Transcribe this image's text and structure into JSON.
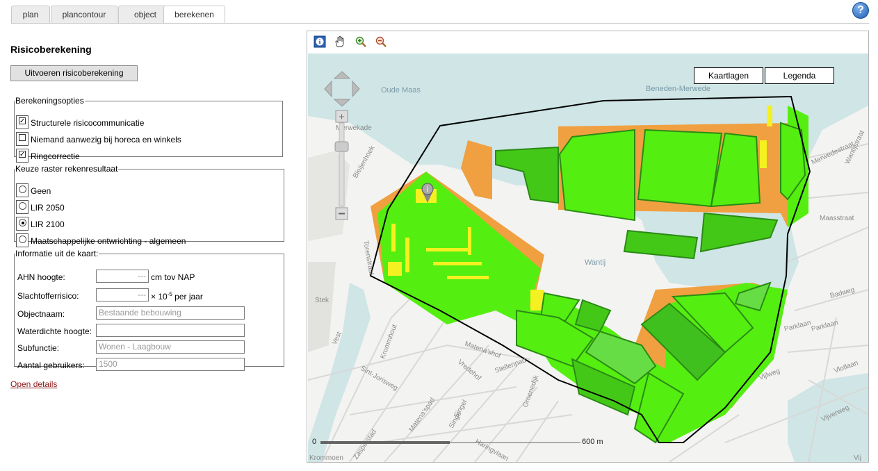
{
  "tabs": [
    {
      "label": "plan",
      "active": false
    },
    {
      "label": "plancontour",
      "active": false
    },
    {
      "label": "object",
      "active": false
    },
    {
      "label": "berekenen",
      "active": true
    }
  ],
  "help_icon": "?",
  "heading": "Risicoberekening",
  "run_button": "Uitvoeren risicoberekening",
  "options": {
    "legend": "Berekeningsopties",
    "items": [
      {
        "label": "Structurele risicocommunicatie",
        "checked": true
      },
      {
        "label": "Niemand aanwezig bij horeca en winkels",
        "checked": false
      },
      {
        "label": "Ringcorrectie",
        "checked": true
      }
    ]
  },
  "raster": {
    "legend": "Keuze raster rekenresultaat",
    "items": [
      {
        "label": "Geen",
        "selected": false
      },
      {
        "label": "LIR 2050",
        "selected": false
      },
      {
        "label": "LIR 2100",
        "selected": true
      },
      {
        "label": "Maatschappelijke ontwrichting - algemeen",
        "selected": false
      }
    ]
  },
  "info": {
    "legend": "Informatie uit de kaart:",
    "ahn": {
      "label": "AHN hoogte:",
      "value": "---",
      "unit": "cm tov NAP"
    },
    "risk": {
      "label": "Slachtofferrisico:",
      "value": "---",
      "unit_prefix": "× 10",
      "unit_exp": "-5",
      "unit_suffix": " per jaar"
    },
    "object_name": {
      "label": "Objectnaam:",
      "value": "Bestaande bebouwing"
    },
    "waterproof": {
      "label": "Waterdichte hoogte:",
      "value": ""
    },
    "subfunction": {
      "label": "Subfunctie:",
      "value": "Wonen - Laagbouw"
    },
    "users": {
      "label": "Aantal gebruikers:",
      "value": "1500"
    }
  },
  "open_details": "Open details",
  "map": {
    "buttons": {
      "layers": "Kaartlagen",
      "legend": "Legenda"
    },
    "scale": {
      "start": "0",
      "end": "600 m"
    },
    "labels": [
      "Oude Maas",
      "Beneden-Merwede",
      "Merwekade",
      "Bleijenhoek",
      "Wantij",
      "Torenstraat",
      "Vest",
      "Stek",
      "Krommhout",
      "Matena'shof",
      "Vredehof",
      "Stellenpad",
      "Sint-Jorisweg",
      "Matena'spad",
      "Singel",
      "Groenedijk",
      "Merwedestraat",
      "Wantijstraat",
      "Maasstraat",
      "Badweg",
      "Parklaan",
      "Vlotlaan",
      "Vijlweg",
      "Vijverweg",
      "Haringvlaan",
      "Krommoen",
      "Zasperstad",
      "Singe",
      "Vij"
    ],
    "colors": {
      "water": "#cfe5e6",
      "land": "#f3f3f1",
      "green_bright": "#55ee11",
      "green_light": "#66dd44",
      "green_dark": "#3fc01e",
      "yellow": "#f5f020",
      "orange": "#f0a040",
      "outline": "#000000"
    }
  }
}
